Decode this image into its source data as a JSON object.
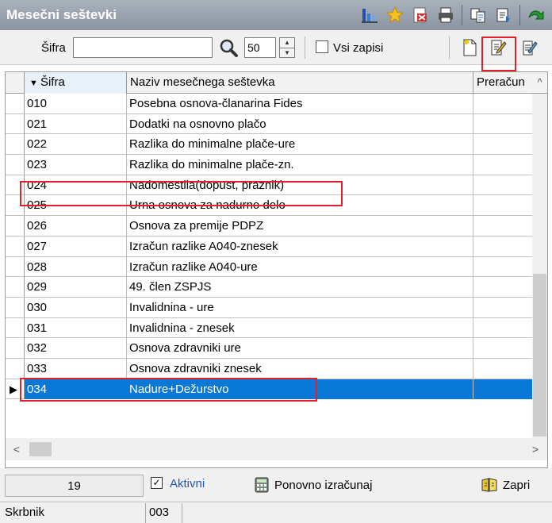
{
  "window": {
    "title": "Mesečni seštevki"
  },
  "toolbar": {
    "sifra_label": "Šifra",
    "sifra_value": "",
    "row_count_value": "50",
    "all_records_label": "Vsi zapisi"
  },
  "grid": {
    "columns": [
      "Šifra",
      "Naziv mesečnega seštevka",
      "Preračun"
    ],
    "rows": [
      {
        "code": "010",
        "name": "Posebna osnova-članarina Fides",
        "recalc": ""
      },
      {
        "code": "021",
        "name": "Dodatki na osnovno plačo",
        "recalc": ""
      },
      {
        "code": "022",
        "name": "Razlika do minimalne plače-ure",
        "recalc": ""
      },
      {
        "code": "023",
        "name": "Razlika do minimalne plače-zn.",
        "recalc": ""
      },
      {
        "code": "024",
        "name": "Nadomestila(dopust, praznik)",
        "recalc": ""
      },
      {
        "code": "025",
        "name": "Urna osnova za nadurno delo",
        "recalc": ""
      },
      {
        "code": "026",
        "name": "Osnova za premije PDPZ",
        "recalc": ""
      },
      {
        "code": "027",
        "name": "Izračun razlike A040-znesek",
        "recalc": ""
      },
      {
        "code": "028",
        "name": "Izračun razlike A040-ure",
        "recalc": ""
      },
      {
        "code": "029",
        "name": "49. člen ZSPJS",
        "recalc": ""
      },
      {
        "code": "030",
        "name": "Invalidnina - ure",
        "recalc": ""
      },
      {
        "code": "031",
        "name": "Invalidnina  - znesek",
        "recalc": ""
      },
      {
        "code": "032",
        "name": "Osnova zdravniki ure",
        "recalc": ""
      },
      {
        "code": "033",
        "name": "Osnova zdravniki znesek",
        "recalc": ""
      },
      {
        "code": "034",
        "name": "Nadure+Dežurstvo",
        "recalc": ""
      }
    ]
  },
  "footer": {
    "record_count": "19",
    "active_label": "Aktivni",
    "recalculate_label": "Ponovno izračunaj",
    "close_label": "Zapri"
  },
  "status": {
    "left": "Skrbnik",
    "middle": "003",
    "right": ""
  },
  "colors": {
    "selection": "#0a78d7",
    "highlight": "#e0202a",
    "active_link": "#1e56c8"
  }
}
